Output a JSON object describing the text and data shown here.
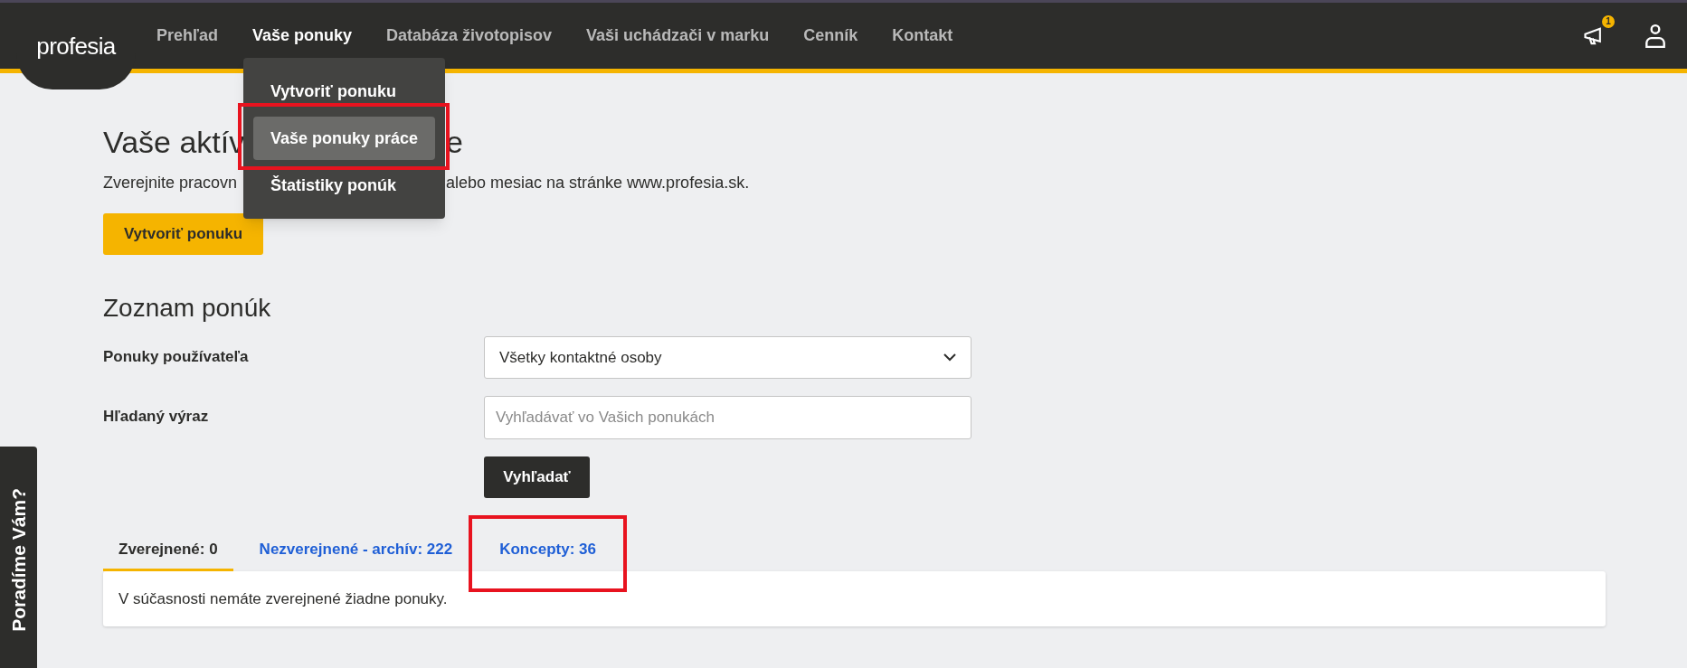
{
  "header": {
    "logo": "profesia",
    "nav": [
      {
        "label": "Prehľad",
        "selected": false
      },
      {
        "label": "Vaše ponuky",
        "selected": true
      },
      {
        "label": "Databáza životopisov",
        "selected": false
      },
      {
        "label": "Vaši uchádzači v marku",
        "selected": false
      },
      {
        "label": "Cenník",
        "selected": false
      },
      {
        "label": "Kontakt",
        "selected": false
      }
    ],
    "notification_badge": "1"
  },
  "dropdown": {
    "items": [
      {
        "label": "Vytvoriť ponuku",
        "selected": false
      },
      {
        "label": "Vaše ponuky práce",
        "selected": true
      },
      {
        "label": "Štatistiky ponúk",
        "selected": false
      }
    ]
  },
  "heading": {
    "visible_start": "Vaše aktív",
    "visible_end": "e"
  },
  "intro": {
    "visible_start": "Zverejnite pracovn",
    "visible_end": "alebo mesiac na stránke www.profesia.sk."
  },
  "create_button": "Vytvoriť ponuku",
  "list_title": "Zoznam ponúk",
  "filters": {
    "user_label": "Ponuky používateľa",
    "user_value": "Všetky kontaktné osoby",
    "search_label": "Hľadaný výraz",
    "search_placeholder": "Vyhľadávať vo Vašich ponukách",
    "search_button": "Vyhľadať"
  },
  "tabs": [
    {
      "label": "Zverejnené: 0",
      "selected": true,
      "annotated": false
    },
    {
      "label": "Nezverejnené - archív: 222",
      "selected": false,
      "annotated": false
    },
    {
      "label": "Koncepty: 36",
      "selected": false,
      "annotated": true
    }
  ],
  "empty_message": "V súčasnosti nemáte zverejnené žiadne ponuky.",
  "help_tab": "Poradíme Vám?"
}
